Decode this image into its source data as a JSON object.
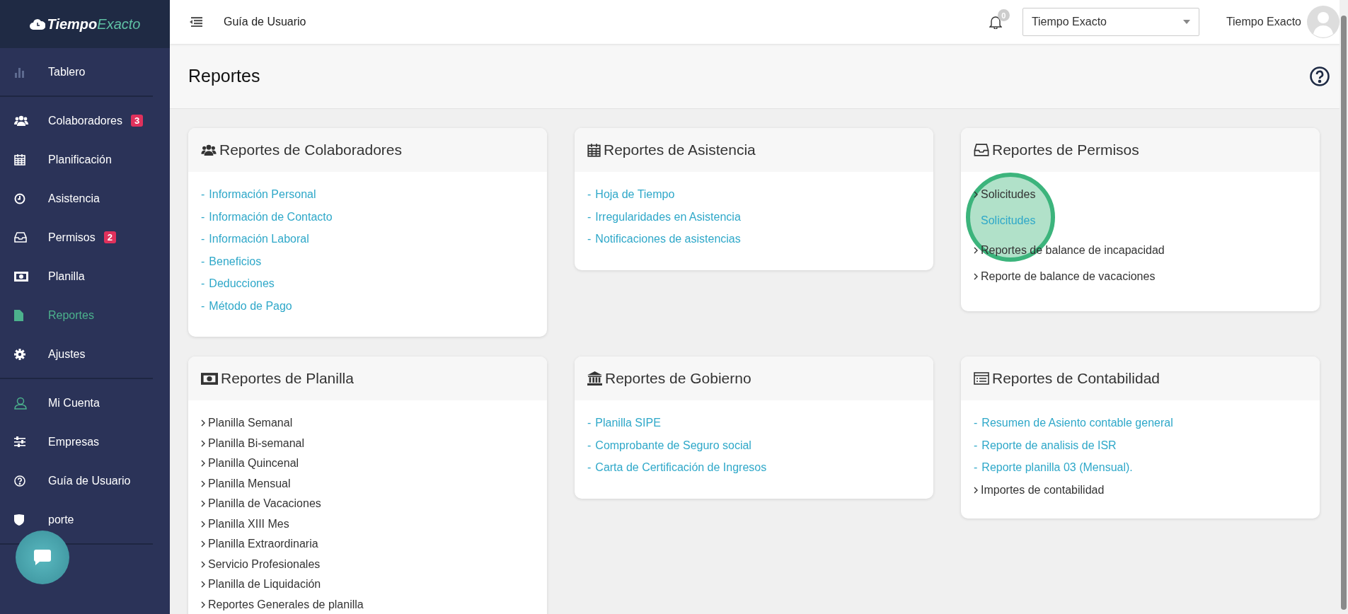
{
  "sidebar": {
    "logo": {
      "first": "Tiempo",
      "second": "Exacto"
    },
    "groups": [
      [
        {
          "label": "Tablero",
          "selected": false
        }
      ],
      [
        {
          "label": "Colaboradores",
          "badge": "3",
          "selected": false
        },
        {
          "label": "Planificación",
          "selected": false
        },
        {
          "label": "Asistencia",
          "selected": false
        },
        {
          "label": "Permisos",
          "badge": "2",
          "selected": false
        },
        {
          "label": "Planilla",
          "selected": false
        },
        {
          "label": "Reportes",
          "selected": true
        },
        {
          "label": "Ajustes",
          "selected": false
        }
      ],
      [
        {
          "label": "Mi Cuenta",
          "selected": false
        },
        {
          "label": "Empresas",
          "selected": false
        },
        {
          "label": "Guía de Usuario",
          "selected": false
        },
        {
          "label": "porte",
          "selected": false
        }
      ]
    ]
  },
  "topbar": {
    "title": "Guía de Usuario",
    "notifications": "0",
    "company_select": {
      "value": "Tiempo Exacto"
    },
    "user_name": "Tiempo Exacto"
  },
  "page": {
    "title": "Reportes"
  },
  "cards": [
    {
      "title": "Reportes de Colaboradores",
      "items": [
        {
          "kind": "dash",
          "marker": "-",
          "label": "Información Personal"
        },
        {
          "kind": "dash",
          "marker": "-",
          "label": "Información de Contacto"
        },
        {
          "kind": "dash",
          "marker": "-",
          "label": "Información Laboral"
        },
        {
          "kind": "dash",
          "marker": "-",
          "label": "Beneficios"
        },
        {
          "kind": "dash",
          "marker": "-",
          "label": "Deducciones"
        },
        {
          "kind": "dash",
          "marker": "-",
          "label": "Método de Pago"
        }
      ]
    },
    {
      "title": "Reportes de Asistencia",
      "items": [
        {
          "kind": "dash",
          "marker": "-",
          "label": "Hoja de Tiempo"
        },
        {
          "kind": "dash",
          "marker": "-",
          "label": "Irregularidades en Asistencia"
        },
        {
          "kind": "dash",
          "marker": "-",
          "label": "Notificaciones de asistencias"
        }
      ]
    },
    {
      "title": "Reportes de Permisos",
      "items": [
        {
          "kind": "chevron",
          "label": "Solicitudes"
        },
        {
          "kind": "sub",
          "label": "Solicitudes"
        },
        {
          "kind": "chevron",
          "label": "Reportes de balance de incapacidad"
        },
        {
          "kind": "chevron",
          "label": "Reporte de balance de vacaciones"
        }
      ]
    },
    {
      "title": "Reportes de Planilla",
      "items": [
        {
          "kind": "chevron",
          "label": "Planilla Semanal"
        },
        {
          "kind": "chevron",
          "label": "Planilla Bi-semanal"
        },
        {
          "kind": "chevron",
          "label": "Planilla Quincenal"
        },
        {
          "kind": "chevron",
          "label": "Planilla Mensual"
        },
        {
          "kind": "chevron",
          "label": "Planilla de Vacaciones"
        },
        {
          "kind": "chevron",
          "label": "Planilla XIII Mes"
        },
        {
          "kind": "chevron",
          "label": "Planilla Extraordinaria"
        },
        {
          "kind": "chevron",
          "label": "Servicio Profesionales"
        },
        {
          "kind": "chevron",
          "label": "Planilla de Liquidación"
        },
        {
          "kind": "chevron",
          "label": "Reportes Generales de planilla"
        }
      ]
    },
    {
      "title": "Reportes de Gobierno",
      "items": [
        {
          "kind": "dash",
          "marker": "-",
          "label": "Planilla SIPE"
        },
        {
          "kind": "dash",
          "marker": "-",
          "label": "Comprobante de Seguro social"
        },
        {
          "kind": "dash",
          "marker": "-",
          "label": "Carta de Certificación de Ingresos"
        }
      ]
    },
    {
      "title": "Reportes de Contabilidad",
      "items": [
        {
          "kind": "dash",
          "marker": "-",
          "label": "Resumen de Asiento contable general"
        },
        {
          "kind": "dash",
          "marker": "-",
          "label": "Reporte de analisis de ISR"
        },
        {
          "kind": "dash",
          "marker": "-",
          "label": "Reporte planilla 03 (Mensual)."
        },
        {
          "kind": "chevron",
          "label": "Importes de contabilidad"
        }
      ]
    }
  ]
}
